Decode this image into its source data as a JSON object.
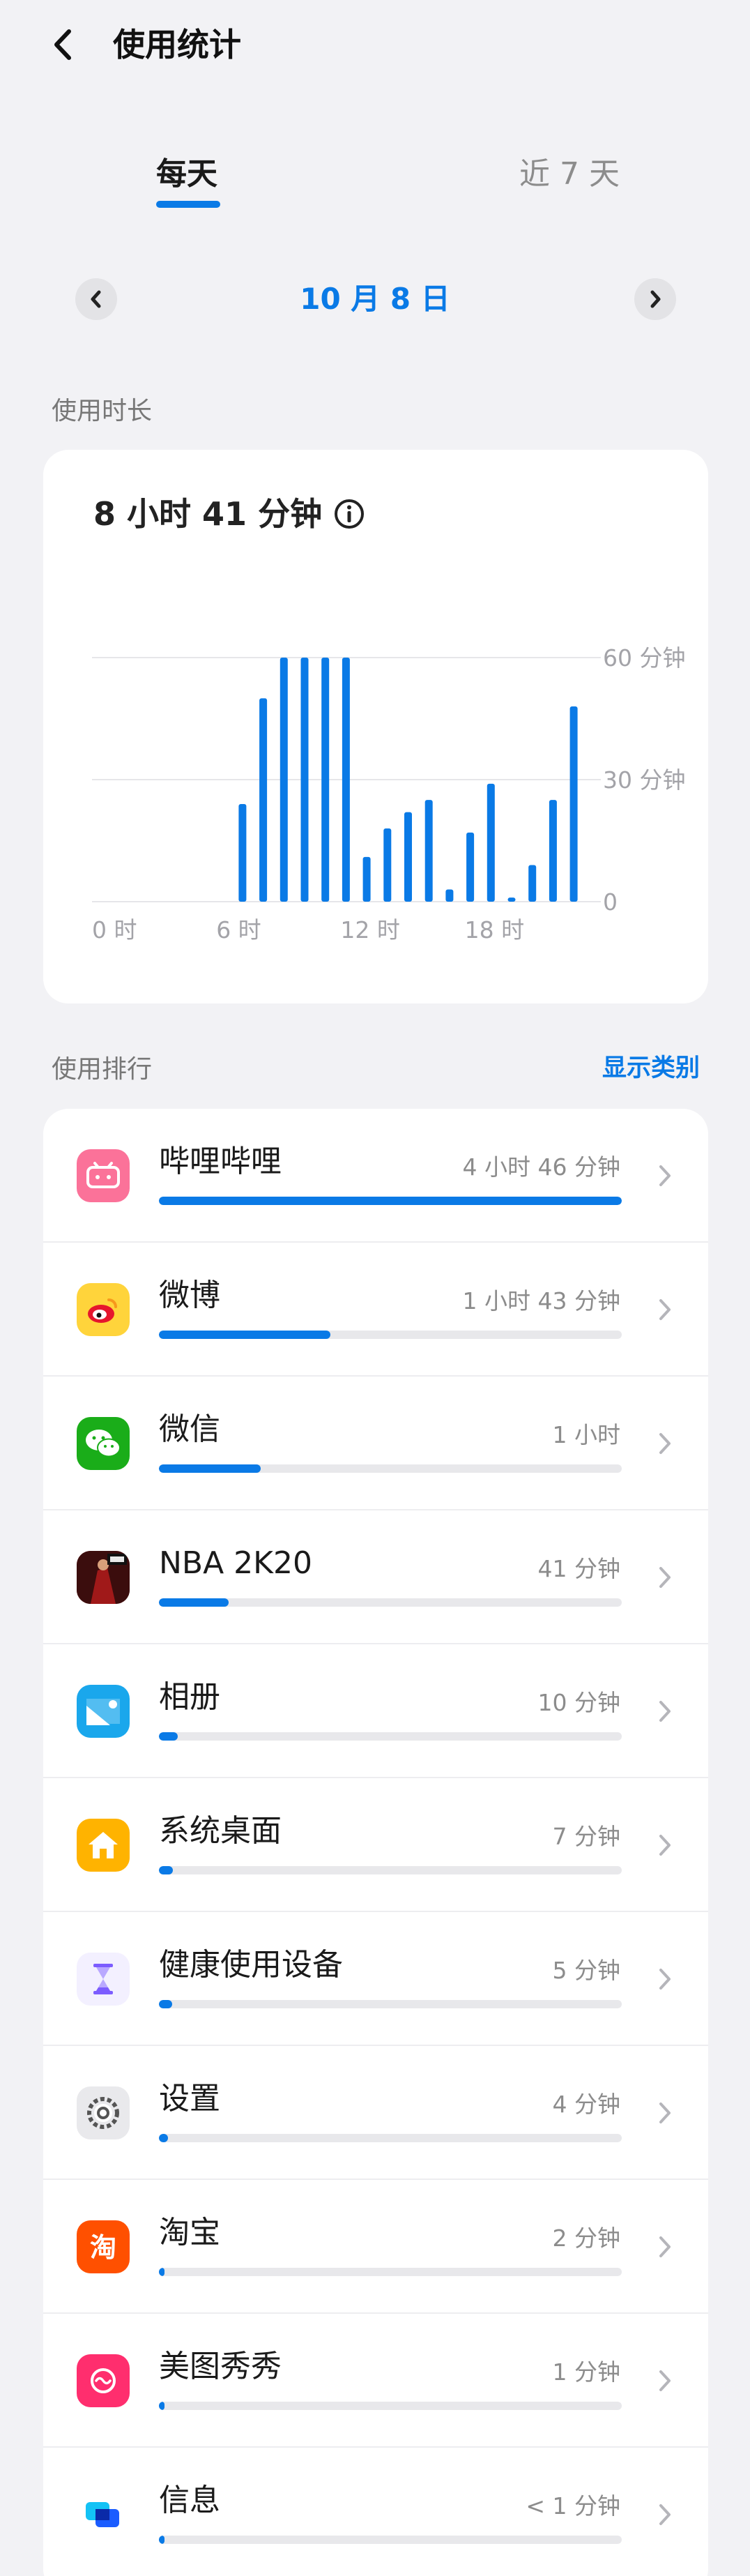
{
  "header": {
    "title": "使用统计"
  },
  "tabs": [
    {
      "label": "每天",
      "active": true
    },
    {
      "label": "近 7 天",
      "active": false
    }
  ],
  "date": {
    "label": "10 月 8 日"
  },
  "usage": {
    "section_label": "使用时长",
    "total": "8 小时 41 分钟"
  },
  "chart_data": {
    "type": "bar",
    "x_tick_labels": [
      "0 时",
      "6 时",
      "12 时",
      "18 时"
    ],
    "y_tick_labels": [
      "60 分钟",
      "30 分钟",
      "0"
    ],
    "x_unit": "hour",
    "y_unit": "minutes",
    "ylim": [
      0,
      60
    ],
    "hours": [
      0,
      1,
      2,
      3,
      4,
      5,
      6,
      7,
      8,
      9,
      10,
      11,
      12,
      13,
      14,
      15,
      16,
      17,
      18,
      19,
      20,
      21,
      22,
      23
    ],
    "values": [
      0,
      0,
      0,
      0,
      0,
      0,
      0,
      24,
      50,
      60,
      60,
      60,
      60,
      11,
      18,
      22,
      25,
      3,
      17,
      29,
      1,
      9,
      25,
      48
    ],
    "grid": true,
    "bar_color": "#0a7ae6"
  },
  "ranking": {
    "section_label": "使用排行",
    "show_category": "显示类别",
    "apps": [
      {
        "name": "哔哩哔哩",
        "time": "4 小时 46 分钟",
        "fraction": 1.0,
        "icon": "bilibili-icon",
        "color": "#fb7299"
      },
      {
        "name": "微博",
        "time": "1 小时 43 分钟",
        "fraction": 0.37,
        "icon": "weibo-icon",
        "color": "#ffd43b"
      },
      {
        "name": "微信",
        "time": "1 小时",
        "fraction": 0.22,
        "icon": "wechat-icon",
        "color": "#1aad19"
      },
      {
        "name": "NBA 2K20",
        "time": "41 分钟",
        "fraction": 0.15,
        "icon": "nba2k20-icon",
        "color": "#8b1a1a"
      },
      {
        "name": "相册",
        "time": "10 分钟",
        "fraction": 0.04,
        "icon": "gallery-icon",
        "color": "#1aa7ec"
      },
      {
        "name": "系统桌面",
        "time": "7 分钟",
        "fraction": 0.03,
        "icon": "home-icon",
        "color": "#ffb300"
      },
      {
        "name": "健康使用设备",
        "time": "5 分钟",
        "fraction": 0.028,
        "icon": "hourglass-icon",
        "color": "#7c5cff"
      },
      {
        "name": "设置",
        "time": "4 分钟",
        "fraction": 0.02,
        "icon": "settings-icon",
        "color": "#9e9e9e"
      },
      {
        "name": "淘宝",
        "time": "2 分钟",
        "fraction": 0.01,
        "icon": "taobao-icon",
        "color": "#ff5000"
      },
      {
        "name": "美图秀秀",
        "time": "1 分钟",
        "fraction": 0.008,
        "icon": "meitu-icon",
        "color": "#ff2e6e"
      },
      {
        "name": "信息",
        "time": "< 1 分钟",
        "fraction": 0.005,
        "icon": "messages-icon",
        "color": "#1a8cff"
      }
    ]
  }
}
